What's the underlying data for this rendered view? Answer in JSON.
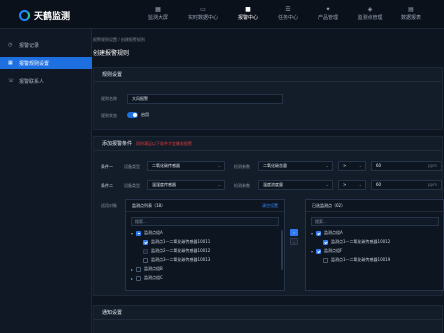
{
  "app": {
    "name": "天鹤监测"
  },
  "nav": [
    {
      "icon": "▦",
      "label": "监测大屏"
    },
    {
      "icon": "▭",
      "label": "实时数据中心"
    },
    {
      "icon": "■",
      "label": "报警中心"
    },
    {
      "icon": "☰",
      "label": "任务中心"
    },
    {
      "icon": "✦",
      "label": "产品管理"
    },
    {
      "icon": "◈",
      "label": "监测点管理"
    },
    {
      "icon": "▤",
      "label": "数据报表"
    }
  ],
  "nav_active": "报警中心",
  "sidebar": [
    {
      "icon": "◷",
      "label": "报警记录"
    },
    {
      "icon": "▦",
      "label": "报警规则设置"
    },
    {
      "icon": "☏",
      "label": "报警联系人"
    }
  ],
  "breadcrumb": "报警规则设置 / 创建报警规则",
  "page_title": "创建报警规则",
  "rules": {
    "title": "规则设置",
    "name_label": "规则名称",
    "name_value": "大风报警",
    "status_label": "规则状态",
    "status_value": "启用",
    "enabled": true
  },
  "conditions": {
    "title": "添加报警条件",
    "hint": "同时满足以下条件才会触发报警",
    "rows": [
      {
        "label": "条件一",
        "device_label": "设备类型",
        "device_value": "二氧化碳传感器",
        "param_label": "检测参数",
        "param_value": "二氧化碳含量",
        "op": ">",
        "value": "60",
        "unit": "ppm"
      },
      {
        "label": "条件二",
        "device_label": "设备类型",
        "device_value": "温湿度传感器",
        "param_label": "检测参数",
        "param_value": "温度浓度量",
        "op": ">",
        "value": "60",
        "unit": "ppm"
      }
    ]
  },
  "applicable": {
    "label": "适用对象",
    "source": {
      "title": "监测点列表（18）",
      "action": "清空设置",
      "search_placeholder": "搜索...",
      "tree": [
        {
          "indent": 0,
          "arrow": "▾",
          "check": "part",
          "label": "监测点组A"
        },
        {
          "indent": 1,
          "arrow": "",
          "check": "on",
          "label": "监测点1—二氧化碳传感器10011"
        },
        {
          "indent": 1,
          "arrow": "",
          "check": "dis",
          "label": "监测点2—二氧化碳传感器10012"
        },
        {
          "indent": 1,
          "arrow": "",
          "check": "off",
          "label": "监测点3—二氧化碳传感器10013"
        },
        {
          "indent": 0,
          "arrow": "▸",
          "check": "off",
          "label": "监测点组B"
        },
        {
          "indent": 0,
          "arrow": "▸",
          "check": "off",
          "label": "监测点组C"
        }
      ]
    },
    "target": {
      "title": "已选监测点（02）",
      "search_placeholder": "搜索...",
      "tree": [
        {
          "indent": 0,
          "arrow": "▾",
          "check": "on",
          "label": "监测点组A"
        },
        {
          "indent": 1,
          "arrow": "",
          "check": "on",
          "label": "监测点1—二氧化碳传感器10012"
        },
        {
          "indent": 0,
          "arrow": "▾",
          "check": "on",
          "label": "监测点组F"
        },
        {
          "indent": 1,
          "arrow": "",
          "check": "off",
          "label": "监测点1—二氧化碳传感器10019"
        }
      ]
    },
    "move_right": "›",
    "move_left": "‹"
  },
  "notify": {
    "title": "通知设置"
  },
  "colors": {
    "accent": "#1e6fe0",
    "warning": "#e83a3a",
    "link": "#3d8bff"
  }
}
